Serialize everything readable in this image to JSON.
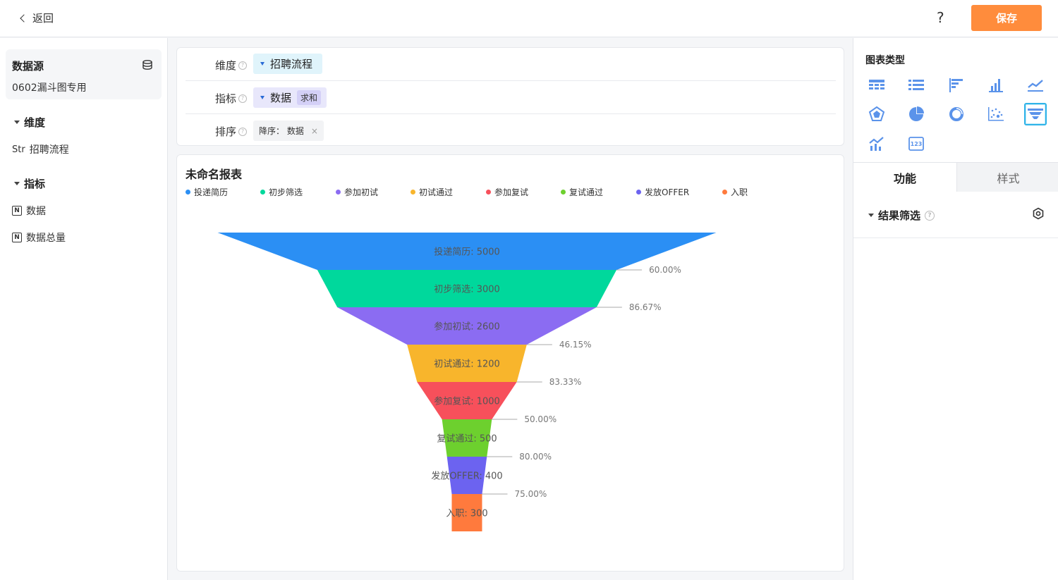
{
  "topbar": {
    "back_label": "返回",
    "help_label": "?",
    "save_label": "保存"
  },
  "left": {
    "datasource_title": "数据源",
    "datasource_name": "0602漏斗图专用",
    "dimension_section": "维度",
    "dimension_fields": [
      {
        "type": "Str",
        "name": "招聘流程"
      }
    ],
    "metric_section": "指标",
    "metric_fields": [
      {
        "type": "N",
        "name": "数据"
      },
      {
        "type": "N",
        "name": "数据总量"
      }
    ]
  },
  "config": {
    "dimension_label": "维度",
    "dimension_value": "招聘流程",
    "metric_label": "指标",
    "metric_value": "数据",
    "metric_agg": "求和",
    "sort_label": "排序",
    "sort_value": "降序： 数据",
    "sort_remove": "×"
  },
  "chart_panel": {
    "title": "未命名报表"
  },
  "chart_data": {
    "type": "funnel",
    "title": "未命名报表",
    "categories": [
      "投递简历",
      "初步筛选",
      "参加初试",
      "初试通过",
      "参加复试",
      "复试通过",
      "发放OFFER",
      "入职"
    ],
    "values": [
      5000,
      3000,
      2600,
      1200,
      1000,
      500,
      400,
      300
    ],
    "conversion_rates": [
      "60.00%",
      "86.67%",
      "46.15%",
      "83.33%",
      "50.00%",
      "80.00%",
      "75.00%"
    ],
    "colors": [
      "#2b8ff4",
      "#00d89c",
      "#8b6cf2",
      "#f8b52c",
      "#f7505b",
      "#6dd02e",
      "#6c63f0",
      "#ff7a3d"
    ],
    "legend_position": "top-left"
  },
  "right": {
    "chart_type_title": "图表类型",
    "chart_types": [
      "table-icon",
      "list-icon",
      "bar-horizontal-icon",
      "bar-vertical-icon",
      "line-icon",
      "radar-icon",
      "pie-icon",
      "donut-icon",
      "scatter-icon",
      "funnel-icon",
      "combo-icon",
      "number-card-icon"
    ],
    "active_chart_type": "funnel-icon",
    "tab_function": "功能",
    "tab_style": "样式",
    "filter_label": "结果筛选"
  }
}
